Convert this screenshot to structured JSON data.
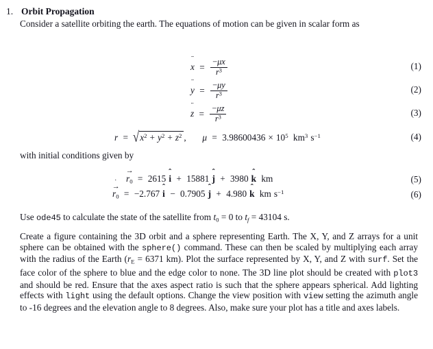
{
  "document": {
    "type": "homework-problem-statement",
    "background_color": "#ffffff",
    "text_color": "#14141e"
  },
  "problem": {
    "number": "1.",
    "title": "Orbit Propagation"
  },
  "paragraphs": {
    "intro_part1": "Consider a satellite orbiting the earth.  The equations of motion can be given in scalar form as",
    "with_initial": "with initial conditions given by",
    "use_ode45": {
      "seg1": "Use ",
      "code1": "ode45",
      "seg2": " to calculate the state of the satellite from ",
      "t0": "t",
      "t0_sub": "0",
      "seg3": " = 0 to ",
      "tf": "t",
      "tf_sub": "f",
      "seg4": " = 43104 s."
    },
    "create_figure": {
      "seg1": "Create a figure containing the 3D orbit and a sphere representing Earth.  The X, Y, and Z arrays for a unit sphere can be obtained with the ",
      "code1": "sphere()",
      "seg2": " command.  These can then be scaled by multiplying each array with the radius of the Earth (",
      "rE": "r",
      "rE_sub": "E",
      "seg3": " = 6371 km). Plot the surface represented by X, Y, and Z with ",
      "code2": "surf",
      "seg4": ". Set the face color of the sphere to blue and the edge color to none.  The 3D line plot should be created with ",
      "code3": "plot3",
      "seg5": " and should be red.  Ensure that the axes aspect ratio is such that the sphere appears spherical.  Add lighting effects with ",
      "code4": "light",
      "seg6": " using the default options.  Change the view position with ",
      "code5": "view",
      "seg7": " setting the azimuth angle to -16 degrees and the elevation angle to 8 degrees.  Also, make sure your plot has a title and axes labels."
    }
  },
  "equations": [
    {
      "tag": "(1)",
      "lhs_var": "x",
      "lhs_accent": "¨",
      "relation": "=",
      "numerator_prefix": "−",
      "numerator_mu": "μ",
      "numerator_var": "x",
      "denominator_var": "r",
      "denominator_exp": "3"
    },
    {
      "tag": "(2)",
      "lhs_var": "y",
      "lhs_accent": "¨",
      "relation": "=",
      "numerator_prefix": "−",
      "numerator_mu": "μ",
      "numerator_var": "y",
      "denominator_var": "r",
      "denominator_exp": "3"
    },
    {
      "tag": "(3)",
      "lhs_var": "z",
      "lhs_accent": "¨",
      "relation": "=",
      "numerator_prefix": "−",
      "numerator_mu": "μ",
      "numerator_var": "z",
      "denominator_var": "r",
      "denominator_exp": "3"
    }
  ],
  "equation4": {
    "tag": "(4)",
    "r_var": "r",
    "relation": "=",
    "radicand": {
      "x": "x",
      "x_exp": "2",
      "plus1": "+",
      "y": "y",
      "y_exp": "2",
      "plus2": "+",
      "z": "z",
      "z_exp": "2"
    },
    "comma": ",",
    "mu_symbol": "μ",
    "mu_relation": "=",
    "mu_mantissa": "3.98600436",
    "mu_times": "×",
    "mu_base": "10",
    "mu_exp": "5",
    "unit_km": "km",
    "unit_km_exp": "3",
    "unit_s": "s",
    "unit_s_exp": "−1"
  },
  "equation5": {
    "tag": "(5)",
    "lhs_var": "r",
    "lhs_sub": "0",
    "lhs_accent": "→",
    "relation": "=",
    "terms": [
      {
        "coef": "2615",
        "unit_vector": "i",
        "op": ""
      },
      {
        "coef": "15881",
        "unit_vector": "j",
        "op": "+"
      },
      {
        "coef": "3980",
        "unit_vector": "k",
        "op": "+"
      }
    ],
    "units": "km"
  },
  "equation6": {
    "tag": "(6)",
    "lhs_var": "r",
    "lhs_sub": "0",
    "lhs_accent": "→",
    "lhs_dot": "˙",
    "relation": "=",
    "terms": [
      {
        "coef": "−2.767",
        "unit_vector": "i",
        "op": ""
      },
      {
        "coef": "0.7905",
        "unit_vector": "j",
        "op": "−"
      },
      {
        "coef": "4.980",
        "unit_vector": "k",
        "op": "+"
      }
    ],
    "units_km": "km",
    "units_s": "s",
    "units_s_exp": "−1"
  },
  "symbols": {
    "hat": "ˆ",
    "arrow": "→",
    "ddot": "¨",
    "radical": "√"
  }
}
